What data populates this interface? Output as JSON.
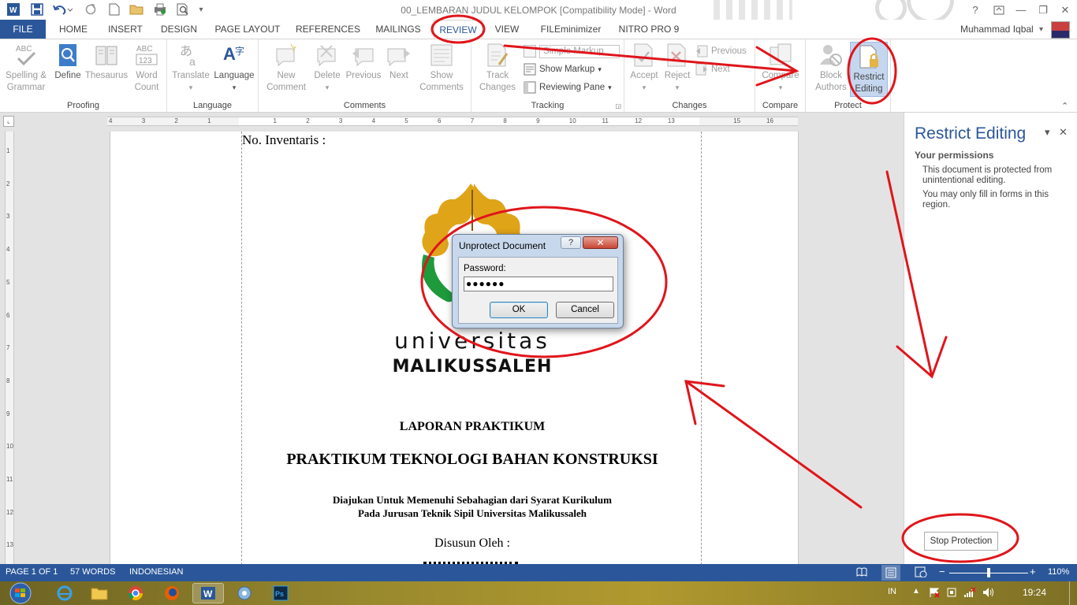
{
  "window": {
    "title": "00_LEMBARAN JUDUL KELOMPOK [Compatibility Mode] - Word",
    "help": "?",
    "minimize": "—",
    "restore": "❐",
    "close": "✕"
  },
  "tabs": [
    "FILE",
    "HOME",
    "INSERT",
    "DESIGN",
    "PAGE LAYOUT",
    "REFERENCES",
    "MAILINGS",
    "REVIEW",
    "VIEW",
    "FILEminimizer",
    "NITRO PRO 9"
  ],
  "active_tab": "REVIEW",
  "user": {
    "name": "Muhammad Iqbal",
    "caret": "▾"
  },
  "ribbon": {
    "proofing": {
      "label": "Proofing",
      "spelling": "Spelling &\nGrammar",
      "define": "Define",
      "thesaurus": "Thesaurus",
      "wordcount": "Word\nCount"
    },
    "language": {
      "label": "Language",
      "translate": "Translate",
      "language": "Language"
    },
    "comments": {
      "label": "Comments",
      "new": "New\nComment",
      "delete": "Delete",
      "previous": "Previous",
      "next": "Next",
      "show": "Show\nComments"
    },
    "tracking": {
      "label": "Tracking",
      "track": "Track\nChanges",
      "simple_markup": "Simple Markup",
      "show_markup": "Show Markup",
      "reviewing_pane": "Reviewing Pane"
    },
    "changes": {
      "label": "Changes",
      "accept": "Accept",
      "reject": "Reject",
      "previous": "Previous",
      "next": "Next"
    },
    "compare": {
      "label": "Compare",
      "compare": "Compare"
    },
    "protect": {
      "label": "Protect",
      "block": "Block\nAuthors",
      "restrict": "Restrict\nEditing"
    }
  },
  "ruler": {
    "h_labels": [
      "4",
      "3",
      "2",
      "1",
      "1",
      "2",
      "3",
      "4",
      "5",
      "6",
      "7",
      "8",
      "9",
      "10",
      "11",
      "12",
      "13",
      "15",
      "16"
    ],
    "v_labels": [
      "1",
      "2",
      "3",
      "4",
      "5",
      "6",
      "7",
      "8",
      "9",
      "10",
      "11",
      "12",
      "13"
    ]
  },
  "document": {
    "inventaris": "No. Inventaris :",
    "logo_text_1": "universitas",
    "logo_text_2": "MALIKUSSALEH",
    "heading_1": "LAPORAN PRAKTIKUM",
    "heading_2": "PRAKTIKUM TEKNOLOGI BAHAN KONSTRUKSI",
    "sub_1": "Diajukan Untuk Memenuhi Sebahagian dari Syarat Kurikulum",
    "sub_2": "Pada Jurusan Teknik Sipil Universitas Malikussaleh",
    "by": "Disusun Oleh :"
  },
  "dialog": {
    "title": "Unprotect Document",
    "help": "?",
    "close": "✕",
    "password_label": "Password:",
    "password_value": "●●●●●●",
    "ok": "OK",
    "cancel": "Cancel"
  },
  "pane": {
    "title": "Restrict Editing",
    "collapse": "▾",
    "close": "✕",
    "heading": "Your permissions",
    "text_1": "This document is protected from unintentional editing.",
    "text_2": "You may only fill in forms in this region.",
    "stop_button": "Stop Protection"
  },
  "status": {
    "page": "PAGE 1 OF 1",
    "words": "57 WORDS",
    "language": "INDONESIAN",
    "zoom": "110%",
    "minus": "−",
    "plus": "+"
  },
  "taskbar": {
    "lang": "IN",
    "clock": "19:24"
  },
  "colors": {
    "accent": "#2b579a",
    "annotation": "#e0151b",
    "logo_gold": "#e0a418",
    "logo_green": "#1e9a3c"
  }
}
